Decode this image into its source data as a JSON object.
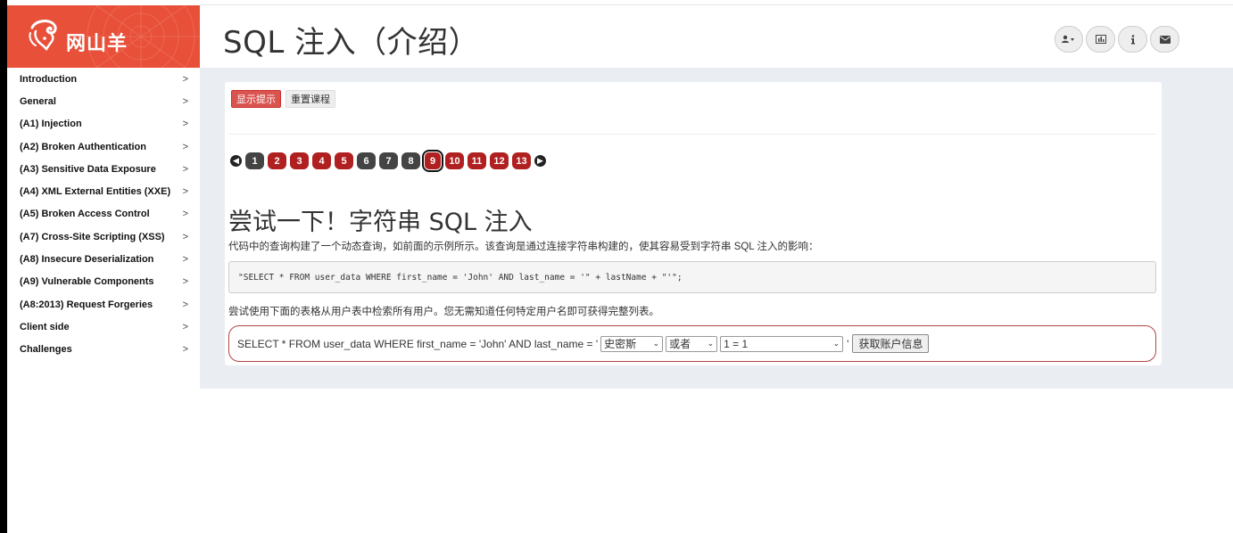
{
  "app": {
    "logo_text": "网山羊"
  },
  "header": {
    "title": "SQL 注入（介绍）",
    "icons": [
      "user-icon",
      "chart-icon",
      "info-icon",
      "envelope-icon"
    ]
  },
  "sidebar": {
    "items": [
      {
        "label": "Introduction",
        "chevron": ">"
      },
      {
        "label": "General",
        "chevron": ">"
      },
      {
        "label": "(A1) Injection",
        "chevron": ">"
      },
      {
        "label": "(A2) Broken Authentication",
        "chevron": ">"
      },
      {
        "label": "(A3) Sensitive Data Exposure",
        "chevron": ">"
      },
      {
        "label": "(A4) XML External Entities (XXE)",
        "chevron": ">"
      },
      {
        "label": "(A5) Broken Access Control",
        "chevron": ">"
      },
      {
        "label": "(A7) Cross-Site Scripting (XSS)",
        "chevron": ">"
      },
      {
        "label": "(A8) Insecure Deserialization",
        "chevron": ">"
      },
      {
        "label": "(A9) Vulnerable Components",
        "chevron": ">"
      },
      {
        "label": "(A8:2013) Request Forgeries",
        "chevron": ">"
      },
      {
        "label": "Client side",
        "chevron": ">"
      },
      {
        "label": "Challenges",
        "chevron": ">"
      }
    ]
  },
  "lesson": {
    "show_hints_label": "显示提示",
    "reset_label": "重置课程",
    "pages": [
      "1",
      "2",
      "3",
      "4",
      "5",
      "6",
      "7",
      "8",
      "9",
      "10",
      "11",
      "12",
      "13"
    ],
    "completed_pages": [
      "1",
      "6",
      "7",
      "8"
    ],
    "current_page": "9",
    "section_title": "尝试一下！字符串 SQL 注入",
    "description": "代码中的查询构建了一个动态查询，如前面的示例所示。该查询是通过连接字符串构建的，使其容易受到字符串 SQL 注入的影响：",
    "code": "\"SELECT * FROM user_data WHERE first_name = 'John' AND last_name = '\" + lastName + \"'\";",
    "instruction": "尝试使用下面的表格从用户表中检索所有用户。您无需知道任何特定用户名即可获得完整列表。",
    "form": {
      "query_prefix": "SELECT * FROM user_data WHERE first_name = 'John' AND last_name = '",
      "select1_value": "史密斯",
      "select2_value": "或者",
      "select3_value": "1 = 1",
      "quote_suffix": "'",
      "submit_label": "获取账户信息"
    }
  },
  "colors": {
    "brand": "#e8503a",
    "hint_button": "#d9534f",
    "page_incomplete": "#b02020",
    "page_complete": "#444444"
  }
}
